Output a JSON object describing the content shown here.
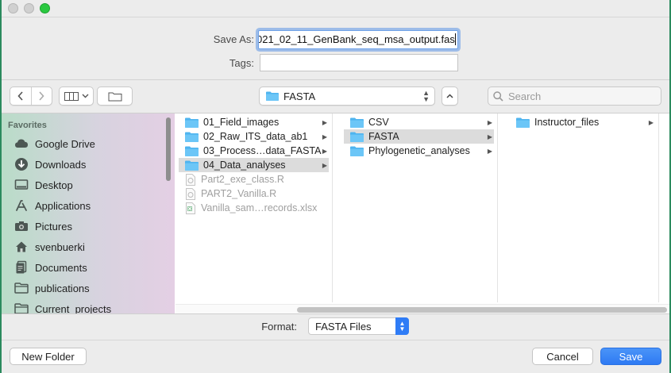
{
  "dialog": {
    "save_as_label": "Save As:",
    "save_as_value": "021_02_11_GenBank_seq_msa_output.fas",
    "tags_label": "Tags:",
    "tags_value": ""
  },
  "toolbar": {
    "location": "FASTA",
    "search_placeholder": "Search"
  },
  "sidebar": {
    "section_title": "Favorites",
    "items": [
      {
        "label": "Google Drive",
        "icon": "cloud-icon"
      },
      {
        "label": "Downloads",
        "icon": "download-icon"
      },
      {
        "label": "Desktop",
        "icon": "desktop-icon"
      },
      {
        "label": "Applications",
        "icon": "applications-icon"
      },
      {
        "label": "Pictures",
        "icon": "camera-icon"
      },
      {
        "label": "svenbuerki",
        "icon": "home-icon"
      },
      {
        "label": "Documents",
        "icon": "document-icon"
      },
      {
        "label": "publications",
        "icon": "folder-icon"
      },
      {
        "label": "Current_projects",
        "icon": "folder-icon"
      }
    ]
  },
  "columns": {
    "col1": [
      {
        "label": "01_Field_images",
        "type": "folder"
      },
      {
        "label": "02_Raw_ITS_data_ab1",
        "type": "folder"
      },
      {
        "label": "03_Process…data_FASTA",
        "type": "folder"
      },
      {
        "label": "04_Data_analyses",
        "type": "folder",
        "selected": true
      },
      {
        "label": "Part2_exe_class.R",
        "type": "file"
      },
      {
        "label": "PART2_Vanilla.R",
        "type": "file"
      },
      {
        "label": "Vanilla_sam…records.xlsx",
        "type": "xlsx"
      }
    ],
    "col2": [
      {
        "label": "CSV",
        "type": "folder"
      },
      {
        "label": "FASTA",
        "type": "folder",
        "selected": true
      },
      {
        "label": "Phylogenetic_analyses",
        "type": "folder"
      }
    ],
    "col3": [
      {
        "label": "Instructor_files",
        "type": "folder"
      }
    ]
  },
  "format": {
    "label": "Format:",
    "value": "FASTA Files"
  },
  "buttons": {
    "new_folder": "New Folder",
    "cancel": "Cancel",
    "save": "Save"
  },
  "colors": {
    "accent": "#2f7cf6",
    "folder": "#4fb4ef"
  }
}
